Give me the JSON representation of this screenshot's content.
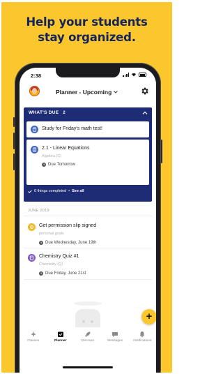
{
  "headline": {
    "line1": "Help your students",
    "line2": "stay organized."
  },
  "status_bar": {
    "time": "2:38"
  },
  "header": {
    "title": "Planner - Upcoming"
  },
  "whats_due": {
    "label": "WHAT'S DUE",
    "count": "2",
    "items": [
      {
        "title": "Study for Friday's math test!"
      },
      {
        "title": "2.1 - Linear Equations",
        "subtitle": "Algebra (C)",
        "due": "Due Tomorrow"
      }
    ],
    "completed_text": "0 things completed",
    "separator": "•",
    "see_all": "See all"
  },
  "section": {
    "label": "JUNE 2019"
  },
  "upcoming": [
    {
      "title": "Get permission slip signed",
      "subtitle": "personal goals",
      "due": "Due Wednesday, June 19th",
      "color": "#f0b92a"
    },
    {
      "title": "Chemistry Quiz #1",
      "subtitle": "Chemistry (Q)",
      "due": "Due Friday, June 21st",
      "color": "#7e57c2"
    }
  ],
  "fab": {
    "label": "+"
  },
  "tabs": [
    {
      "label": "Classes",
      "icon": "classes-icon"
    },
    {
      "label": "Planner",
      "icon": "planner-icon"
    },
    {
      "label": "Discover",
      "icon": "rocket-icon"
    },
    {
      "label": "Messages",
      "icon": "messages-icon"
    },
    {
      "label": "Notifications",
      "icon": "notifications-icon"
    }
  ],
  "colors": {
    "background": "#fcc72c",
    "headline": "#15245c",
    "due_panel": "#1e2c75",
    "task_icon_blue": "#3b63c9"
  }
}
